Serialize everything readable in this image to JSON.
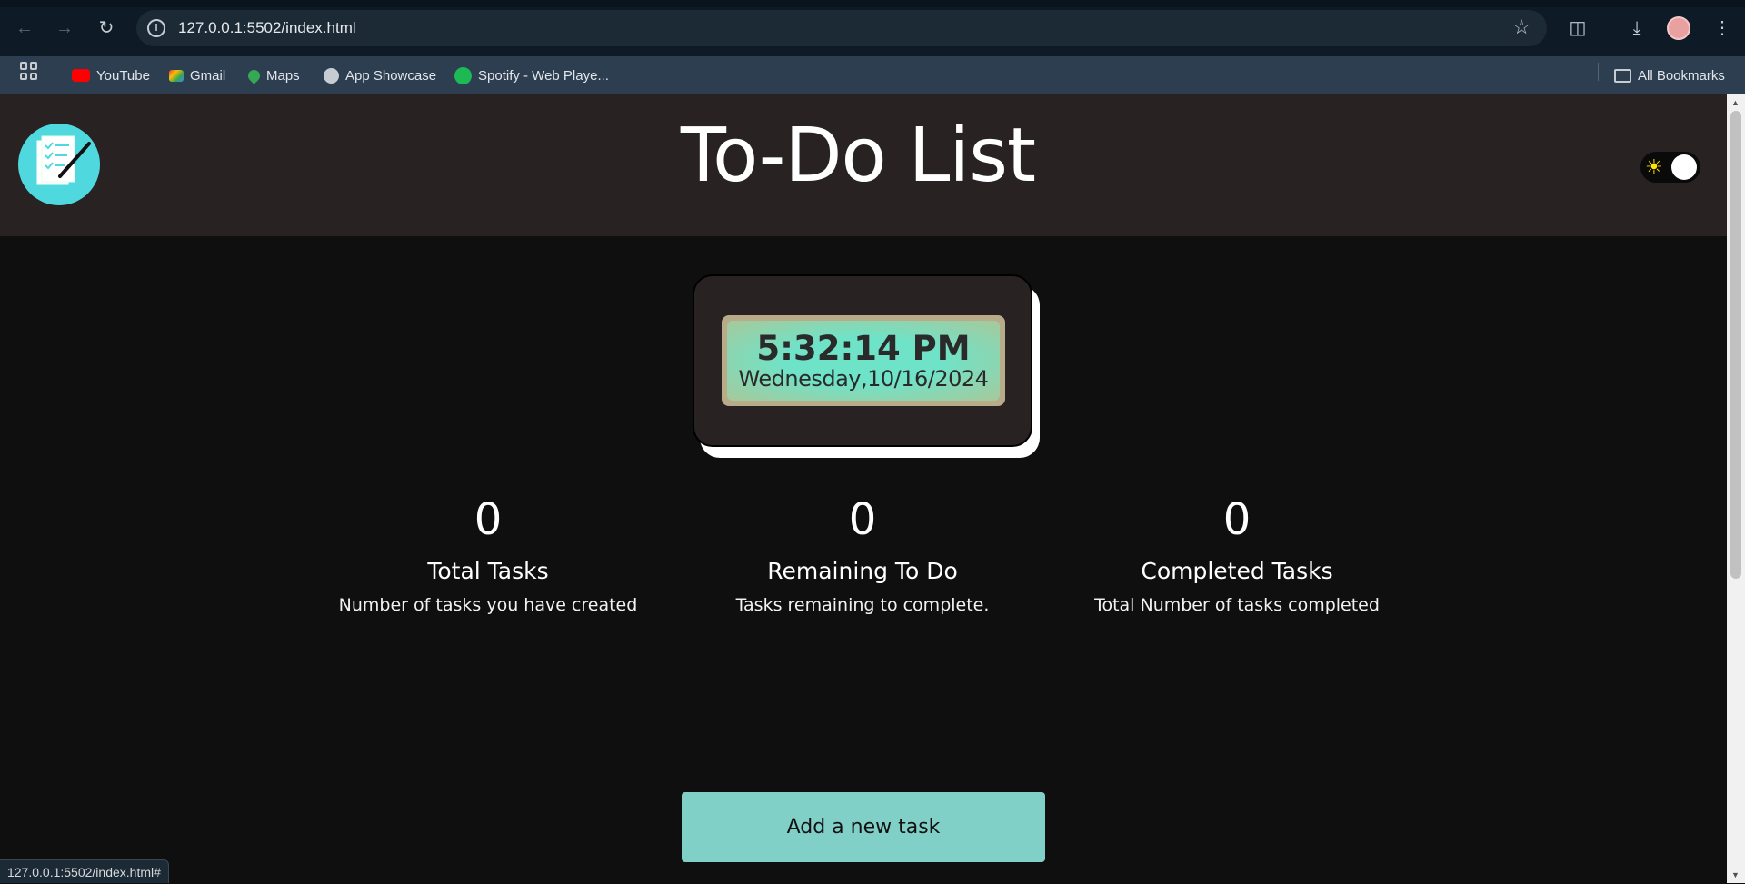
{
  "browser": {
    "url": "127.0.0.1:5502/index.html",
    "status_url": "127.0.0.1:5502/index.html#",
    "bookmarks": [
      {
        "label": "YouTube",
        "icon": "youtube-icon",
        "color": "#ff0000"
      },
      {
        "label": "Gmail",
        "icon": "gmail-icon",
        "color": "#ea4335"
      },
      {
        "label": "Maps",
        "icon": "maps-icon",
        "color": "#34a853"
      },
      {
        "label": "App Showcase",
        "icon": "globe-icon",
        "color": "#c6ccd2"
      },
      {
        "label": "Spotify - Web Playe...",
        "icon": "spotify-icon",
        "color": "#1db954"
      }
    ],
    "all_bookmarks_label": "All Bookmarks"
  },
  "header": {
    "title": "To-Do List",
    "logo_icon": "checklist-pen-icon",
    "logo_color": "#4fd9df",
    "theme_toggle_icon": "sun-icon"
  },
  "clock": {
    "time": "5:32:14 PM",
    "date": "Wednesday,10/16/2024"
  },
  "stats": [
    {
      "value": "0",
      "label": "Total Tasks",
      "desc": "Number of tasks you have created"
    },
    {
      "value": "0",
      "label": "Remaining To Do",
      "desc": "Tasks remaining to complete."
    },
    {
      "value": "0",
      "label": "Completed Tasks",
      "desc": "Total Number of tasks completed"
    }
  ],
  "actions": {
    "add_task_label": "Add a new task",
    "accent": "#80d0c8"
  }
}
